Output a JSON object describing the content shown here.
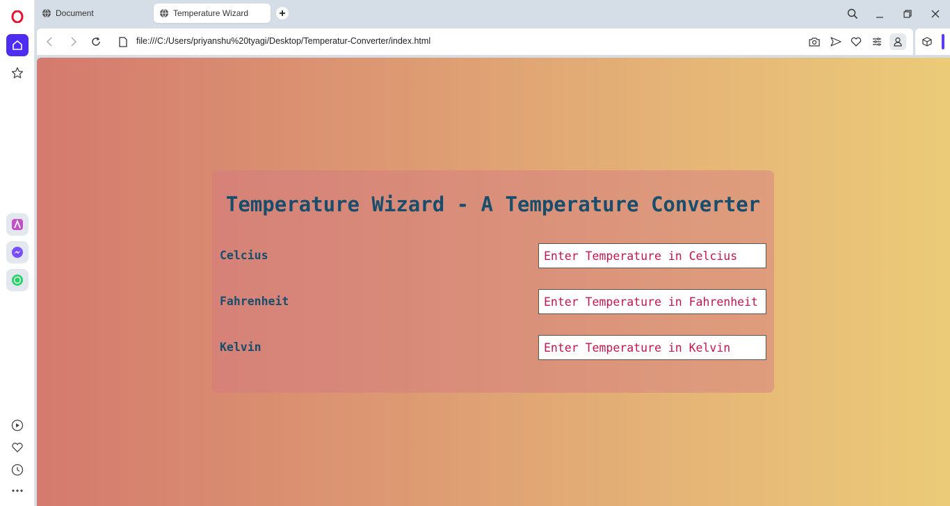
{
  "browser": {
    "tabs": [
      {
        "label": "Document",
        "active": false
      },
      {
        "label": "Temperature Wizard",
        "active": true
      }
    ],
    "url": "file:///C:/Users/priyanshu%20tyagi/Desktop/Temperatur-Converter/index.html",
    "accent_color": "#4f2cf2",
    "sidebar_icons": [
      "opera-logo-icon",
      "home-icon",
      "star-icon",
      "aria-app-icon",
      "messenger-icon",
      "whatsapp-icon",
      "player-icon",
      "heart-icon",
      "history-icon",
      "more-icon"
    ]
  },
  "page": {
    "title": "Temperature Wizard - A Temperature Converter",
    "rows": [
      {
        "label": "Celcius",
        "placeholder": "Enter Temperature in Celcius"
      },
      {
        "label": "Fahrenheit",
        "placeholder": "Enter Temperature in Fahrenheit"
      },
      {
        "label": "Kelvin",
        "placeholder": "Enter Temperature in Kelvin"
      }
    ],
    "colors": {
      "gradient_start": "#d47a6e",
      "gradient_end": "#ebcb78",
      "heading": "#184e6c",
      "input_text": "#c1154d"
    }
  }
}
